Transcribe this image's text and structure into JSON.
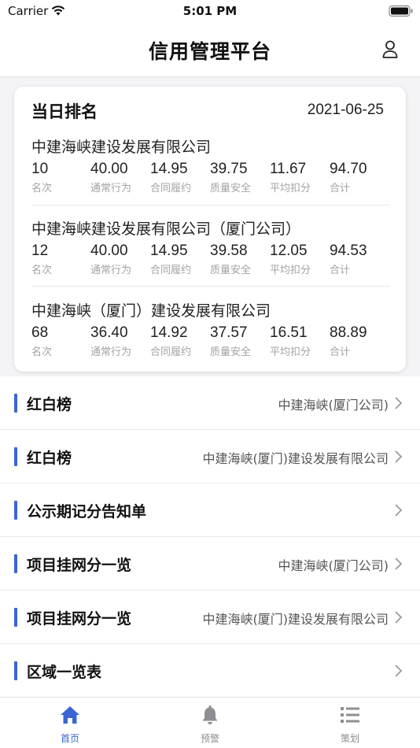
{
  "status_bar": {
    "carrier": "Carrier",
    "time": "5:01 PM"
  },
  "header": {
    "title": "信用管理平台",
    "user_icon": "user-icon"
  },
  "ranking": {
    "title": "当日排名",
    "date": "2021-06-25",
    "labels": [
      "名次",
      "通常行为",
      "合同履约",
      "质量安全",
      "平均扣分",
      "合计"
    ],
    "companies": [
      {
        "name": "中建海峡建设发展有限公司",
        "values": [
          "10",
          "40.00",
          "14.95",
          "39.75",
          "11.67",
          "94.70"
        ]
      },
      {
        "name": "中建海峡建设发展有限公司（厦门公司）",
        "values": [
          "12",
          "40.00",
          "14.95",
          "39.58",
          "12.05",
          "94.53"
        ]
      },
      {
        "name": "中建海峡（厦门）建设发展有限公司",
        "values": [
          "68",
          "36.40",
          "14.92",
          "37.57",
          "16.51",
          "88.89"
        ]
      }
    ]
  },
  "menu": [
    {
      "label": "红白榜",
      "value": "中建海峡(厦门公司)"
    },
    {
      "label": "红白榜",
      "value": "中建海峡(厦门)建设发展有限公司"
    },
    {
      "label": "公示期记分告知单",
      "value": ""
    },
    {
      "label": "项目挂网分一览",
      "value": "中建海峡(厦门公司)"
    },
    {
      "label": "项目挂网分一览",
      "value": "中建海峡(厦门)建设发展有限公司"
    },
    {
      "label": "区域一览表",
      "value": ""
    }
  ],
  "tabs": [
    {
      "label": "首页",
      "icon": "home-icon",
      "active": true
    },
    {
      "label": "预警",
      "icon": "bell-icon",
      "active": false
    },
    {
      "label": "策划",
      "icon": "list-icon",
      "active": false
    }
  ],
  "colors": {
    "accent": "#3a66d3",
    "inactive": "#8e8e93",
    "muted_label": "#a3a3a3"
  }
}
